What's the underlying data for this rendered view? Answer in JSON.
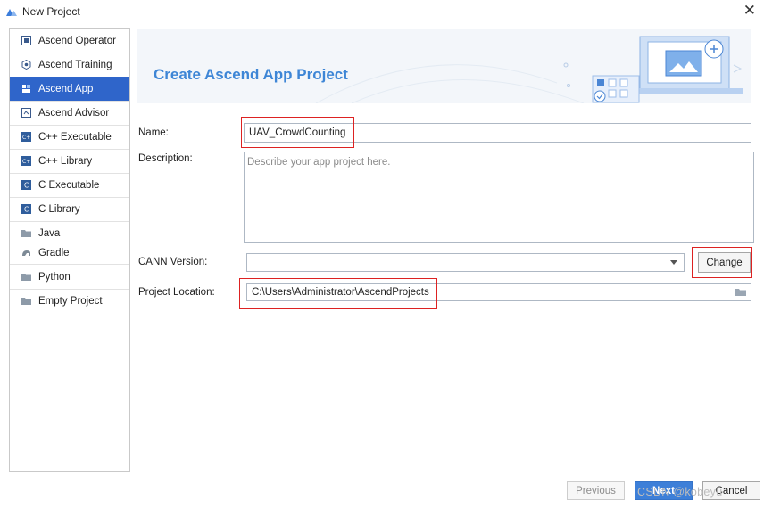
{
  "window": {
    "title": "New Project"
  },
  "sidebar": {
    "items": [
      {
        "label": "Ascend Operator",
        "icon": "ascend-operator-icon"
      },
      {
        "label": "Ascend Training",
        "icon": "ascend-training-icon"
      },
      {
        "label": "Ascend App",
        "icon": "ascend-app-icon",
        "selected": true
      },
      {
        "label": "Ascend Advisor",
        "icon": "ascend-advisor-icon"
      },
      {
        "label": "C++ Executable",
        "icon": "cpp-executable-icon"
      },
      {
        "label": "C++ Library",
        "icon": "cpp-library-icon"
      },
      {
        "label": "C Executable",
        "icon": "c-executable-icon"
      },
      {
        "label": "C Library",
        "icon": "c-library-icon"
      },
      {
        "label": "Java",
        "icon": "java-folder-icon"
      },
      {
        "label": "Gradle",
        "icon": "gradle-icon"
      },
      {
        "label": "Python",
        "icon": "python-folder-icon"
      },
      {
        "label": "Empty Project",
        "icon": "empty-project-icon"
      }
    ]
  },
  "banner": {
    "title": "Create Ascend App Project"
  },
  "form": {
    "name_label": "Name:",
    "name_value": "UAV_CrowdCounting",
    "description_label": "Description:",
    "description_placeholder": "Describe your app project here.",
    "cann_label": "CANN Version:",
    "cann_value": "",
    "change_label": "Change",
    "location_label": "Project Location:",
    "location_value": "C:\\Users\\Administrator\\AscendProjects"
  },
  "footer": {
    "previous_label": "Previous",
    "next_label": "Next",
    "cancel_label": "Cancel"
  },
  "watermark": "CSDN @kobeyu",
  "colors": {
    "accent": "#2f65ca",
    "banner_title": "#3e86d6",
    "highlight_box": "#dd2222"
  }
}
